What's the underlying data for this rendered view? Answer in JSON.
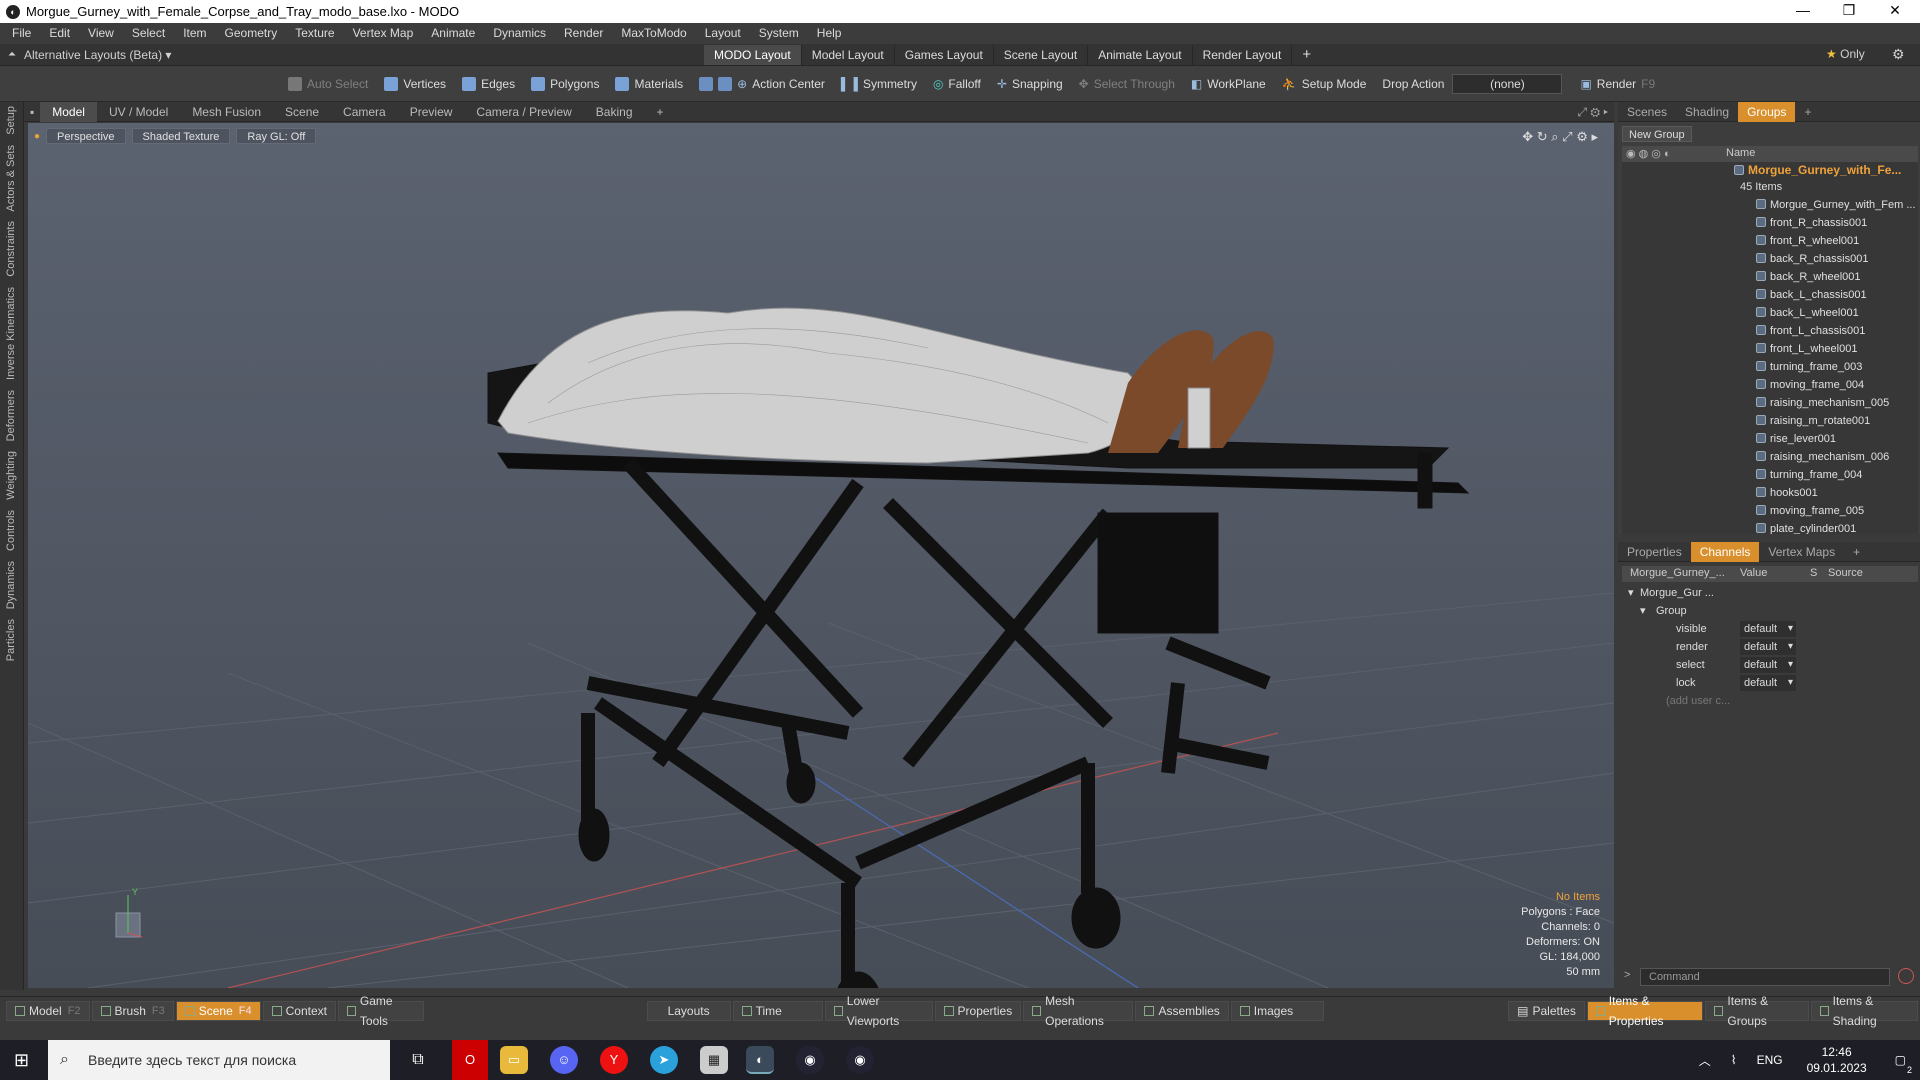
{
  "window": {
    "title": "Morgue_Gurney_with_Female_Corpse_and_Tray_modo_base.lxo - MODO",
    "app_icon": "modo-logo-icon"
  },
  "menu": [
    "File",
    "Edit",
    "View",
    "Select",
    "Item",
    "Geometry",
    "Texture",
    "Vertex Map",
    "Animate",
    "Dynamics",
    "Render",
    "MaxToModo",
    "Layout",
    "System",
    "Help"
  ],
  "layoutbar": {
    "left_label": "Alternative Layouts (Beta)",
    "tabs": [
      "MODO Layout",
      "Model Layout",
      "Games Layout",
      "Scene Layout",
      "Animate Layout",
      "Render Layout"
    ],
    "active_tab": "MODO Layout",
    "only_label": "Only",
    "add_tab": "+"
  },
  "toolbar": {
    "auto_select": "Auto Select",
    "vertices": "Vertices",
    "edges": "Edges",
    "polygons": "Polygons",
    "materials": "Materials",
    "action_center": "Action Center",
    "symmetry": "Symmetry",
    "falloff": "Falloff",
    "snapping": "Snapping",
    "select_through": "Select Through",
    "workplane": "WorkPlane",
    "setup_mode": "Setup Mode",
    "drop_action": "Drop Action",
    "drop_value": "(none)",
    "render": "Render",
    "render_key": "F9"
  },
  "left_tabs": [
    "Setup",
    "Actors & Sets",
    "Constraints",
    "Inverse Kinematics",
    "Deformers",
    "Weighting",
    "Controls",
    "Dynamics",
    "Particles"
  ],
  "viewport_tabs": [
    "Model",
    "UV / Model",
    "Mesh Fusion",
    "Scene",
    "Camera",
    "Preview",
    "Camera / Preview",
    "Baking"
  ],
  "viewport_active": "Model",
  "viewport": {
    "view": "Perspective",
    "shading": "Shaded Texture",
    "raygl": "Ray GL: Off"
  },
  "vpinfo": {
    "items": "No Items",
    "polygons": "Polygons : Face",
    "channels": "Channels: 0",
    "deformers": "Deformers: ON",
    "gl": "GL: 184,000",
    "scale": "50 mm"
  },
  "right_tabs": [
    "Scenes",
    "Shading",
    "Groups"
  ],
  "right_active": "Groups",
  "groups": {
    "new_group": "New Group",
    "name_col": "Name",
    "root_name": "Morgue_Gurney_with_Fe...",
    "root_count": "45 Items",
    "items": [
      "Morgue_Gurney_with_Fem ...",
      "front_R_chassis001",
      "front_R_wheel001",
      "back_R_chassis001",
      "back_R_wheel001",
      "back_L_chassis001",
      "back_L_wheel001",
      "front_L_chassis001",
      "front_L_wheel001",
      "turning_frame_003",
      "moving_frame_004",
      "raising_mechanism_005",
      "raising_m_rotate001",
      "rise_lever001",
      "raising_mechanism_006",
      "turning_frame_004",
      "hooks001",
      "moving_frame_005",
      "plate_cylinder001"
    ]
  },
  "props_tabs": [
    "Properties",
    "Channels",
    "Vertex Maps"
  ],
  "props_active": "Channels",
  "channels": {
    "head_name": "Morgue_Gurney_...",
    "head_value": "Value",
    "head_s": "S",
    "head_source": "Source",
    "item": "Morgue_Gur ...",
    "group": "Group",
    "rows": [
      {
        "name": "visible",
        "value": "default"
      },
      {
        "name": "render",
        "value": "default"
      },
      {
        "name": "select",
        "value": "default"
      },
      {
        "name": "lock",
        "value": "default"
      }
    ],
    "add_user": "(add user c..."
  },
  "command_placeholder": "Command",
  "bottom": {
    "left": [
      {
        "label": "Model",
        "key": "F2"
      },
      {
        "label": "Brush",
        "key": "F3"
      },
      {
        "label": "Scene",
        "key": "F4"
      },
      {
        "label": "Context",
        "key": ""
      },
      {
        "label": "Game Tools",
        "key": ""
      }
    ],
    "active_left": "Scene",
    "middle": [
      "Layouts",
      "Time",
      "Lower Viewports",
      "Properties",
      "Mesh Operations",
      "Assemblies",
      "Images"
    ],
    "right": [
      "Palettes",
      "Items & Properties",
      "Items & Groups",
      "Items & Shading"
    ],
    "active_right": "Items & Properties"
  },
  "taskbar": {
    "search": "Введите здесь текст для поиска",
    "lang": "ENG",
    "time": "12:46",
    "date": "09.01.2023",
    "badge_notif": "2"
  },
  "colors": {
    "accent": "#d88f2c",
    "viewport_top": "#5b6270",
    "viewport_bottom": "#474d57"
  }
}
